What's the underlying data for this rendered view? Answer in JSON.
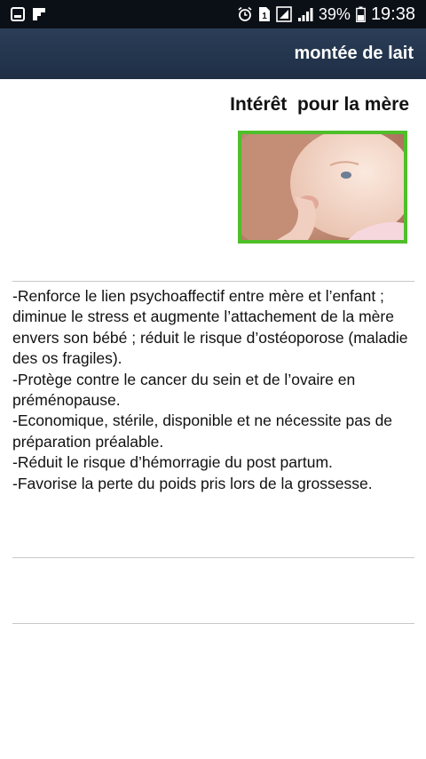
{
  "status_bar": {
    "battery_percent": "39%",
    "time": "19:38",
    "left_icons": [
      "gallery-icon",
      "flipboard-icon"
    ],
    "right_icons": [
      "alarm-icon",
      "sim-icon",
      "signal-icon",
      "battery-icon"
    ]
  },
  "toolbar": {
    "title": "montée de lait"
  },
  "content": {
    "title": "Intérêt  pour la mère",
    "paragraphs": [
      "-Renforce le lien psychoaffectif entre mère et l’enfant ; diminue le stress et augmente l’attachement de la mère envers son bébé ; réduit le risque d’ostéoporose (maladie des os fragiles).",
      "-Protège contre le cancer du sein et de l’ovaire en préménopause.",
      "-Economique, stérile, disponible et ne nécessite pas de préparation préalable.",
      "-Réduit le risque d’hémorragie du post partum.",
      "-Favorise la perte du poids pris lors de la grossesse."
    ]
  },
  "colors": {
    "status_bar": "#0b0f16",
    "toolbar": "#24364f",
    "photo_border": "#4fbf2a",
    "divider": "#c8c8c8"
  }
}
